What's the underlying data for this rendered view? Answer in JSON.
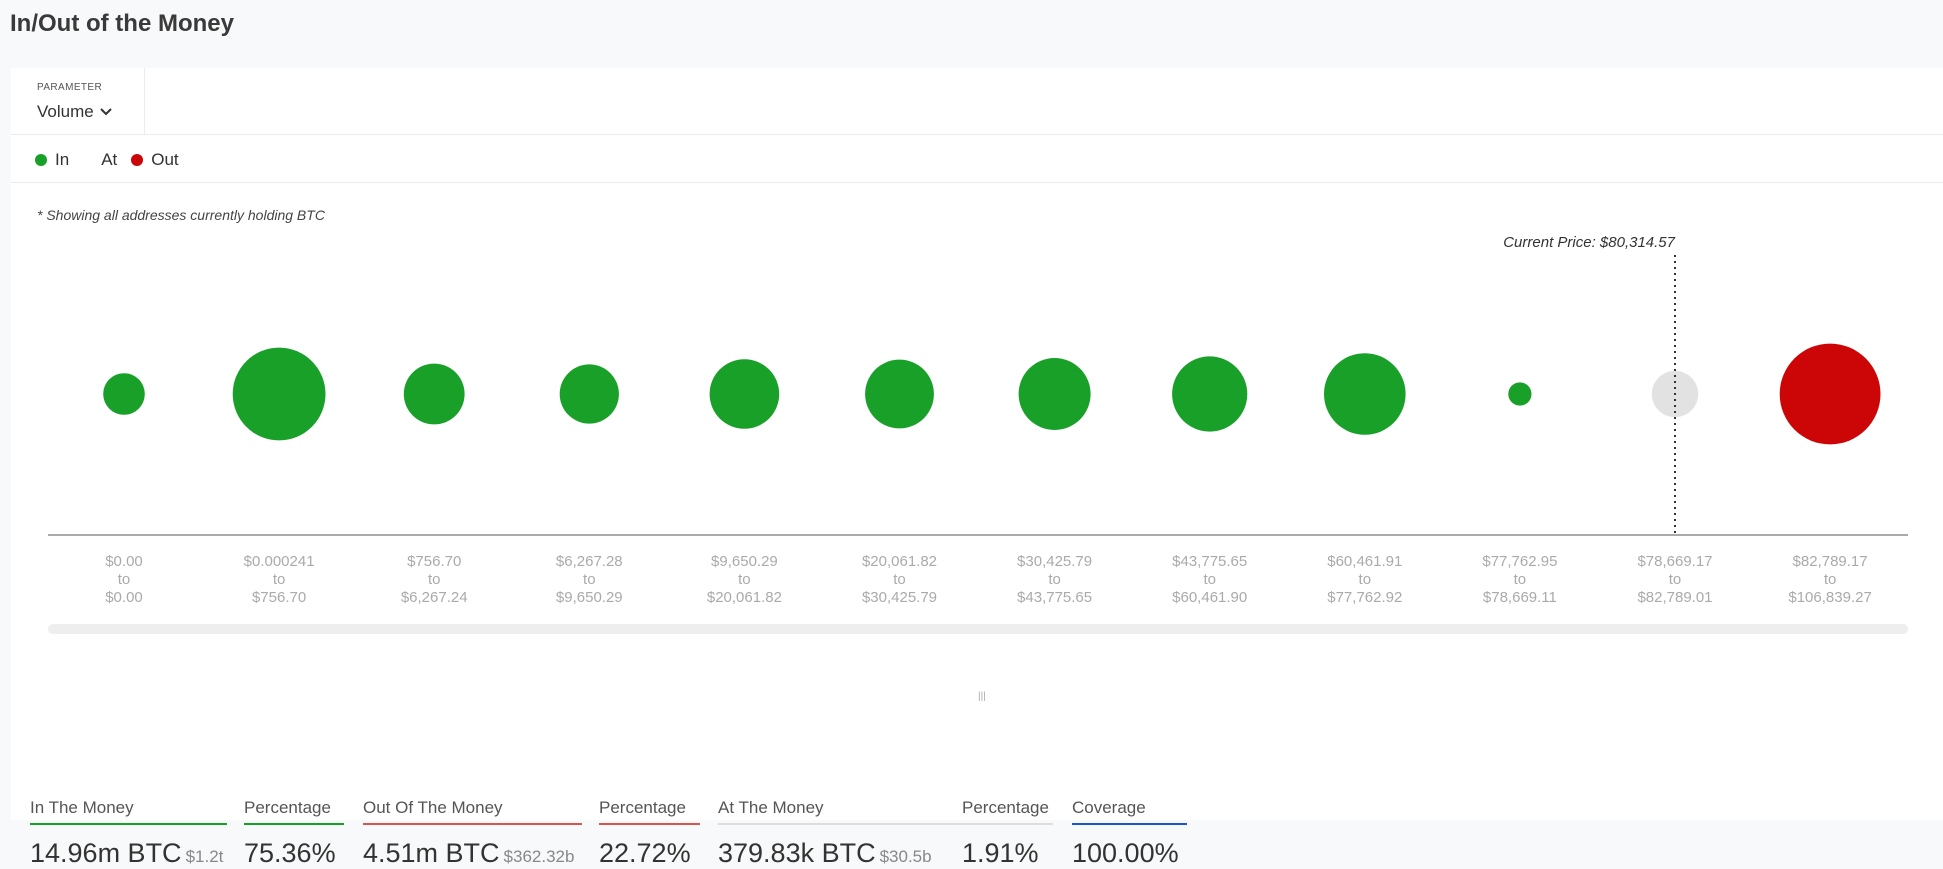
{
  "page": {
    "title": "In/Out of the Money"
  },
  "parameter": {
    "label": "PARAMETER",
    "value": "Volume"
  },
  "legend": [
    {
      "label": "In",
      "color": "#18a028"
    },
    {
      "label": "At",
      "color": ""
    },
    {
      "label": "Out",
      "color": "#cc0606"
    }
  ],
  "colors": {
    "in": "#18a028",
    "out": "#cc0606",
    "at": "#e2e2e2",
    "coverage": "#1f54c8"
  },
  "chart_data": {
    "type": "bubble",
    "note": "* Showing all addresses currently holding BTC",
    "current_price_label": "Current Price: $80,314.57",
    "current_price_bin": 10,
    "categories": [
      {
        "from": "$0.00",
        "to_word": "to",
        "to": "$0.00",
        "status": "in",
        "relative_size": 0.52
      },
      {
        "from": "$0.000241",
        "to_word": "to",
        "to": "$756.70",
        "status": "in",
        "relative_size": 1.16
      },
      {
        "from": "$756.70",
        "to_word": "to",
        "to": "$6,267.24",
        "status": "in",
        "relative_size": 0.76
      },
      {
        "from": "$6,267.28",
        "to_word": "to",
        "to": "$9,650.29",
        "status": "in",
        "relative_size": 0.74
      },
      {
        "from": "$9,650.29",
        "to_word": "to",
        "to": "$20,061.82",
        "status": "in",
        "relative_size": 0.87
      },
      {
        "from": "$20,061.82",
        "to_word": "to",
        "to": "$30,425.79",
        "status": "in",
        "relative_size": 0.86
      },
      {
        "from": "$30,425.79",
        "to_word": "to",
        "to": "$43,775.65",
        "status": "in",
        "relative_size": 0.9
      },
      {
        "from": "$43,775.65",
        "to_word": "to",
        "to": "$60,461.90",
        "status": "in",
        "relative_size": 0.94
      },
      {
        "from": "$60,461.91",
        "to_word": "to",
        "to": "$77,762.92",
        "status": "in",
        "relative_size": 1.02
      },
      {
        "from": "$77,762.95",
        "to_word": "to",
        "to": "$78,669.11",
        "status": "in",
        "relative_size": 0.29
      },
      {
        "from": "$78,669.17",
        "to_word": "to",
        "to": "$82,789.01",
        "status": "at",
        "relative_size": 0.58
      },
      {
        "from": "$82,789.17",
        "to_word": "to",
        "to": "$106,839.27",
        "status": "out",
        "relative_size": 1.26
      }
    ]
  },
  "metrics": [
    {
      "header": "In The Money",
      "value": "14.96m BTC",
      "sub": "$1.2t",
      "color": "#18a028"
    },
    {
      "header": "Percentage",
      "value": "75.36%",
      "sub": "",
      "color": "#18a028"
    },
    {
      "header": "Out Of The Money",
      "value": "4.51m BTC",
      "sub": "$362.32b",
      "color": "#d9534f"
    },
    {
      "header": "Percentage",
      "value": "22.72%",
      "sub": "",
      "color": "#d9534f"
    },
    {
      "header": "At The Money",
      "value": "379.83k BTC",
      "sub": "$30.5b",
      "color": "#dddddd"
    },
    {
      "header": "Percentage",
      "value": "1.91%",
      "sub": "",
      "color": "#dddddd"
    },
    {
      "header": "Coverage",
      "value": "100.00%",
      "sub": "",
      "color": "#1f54c8"
    }
  ]
}
